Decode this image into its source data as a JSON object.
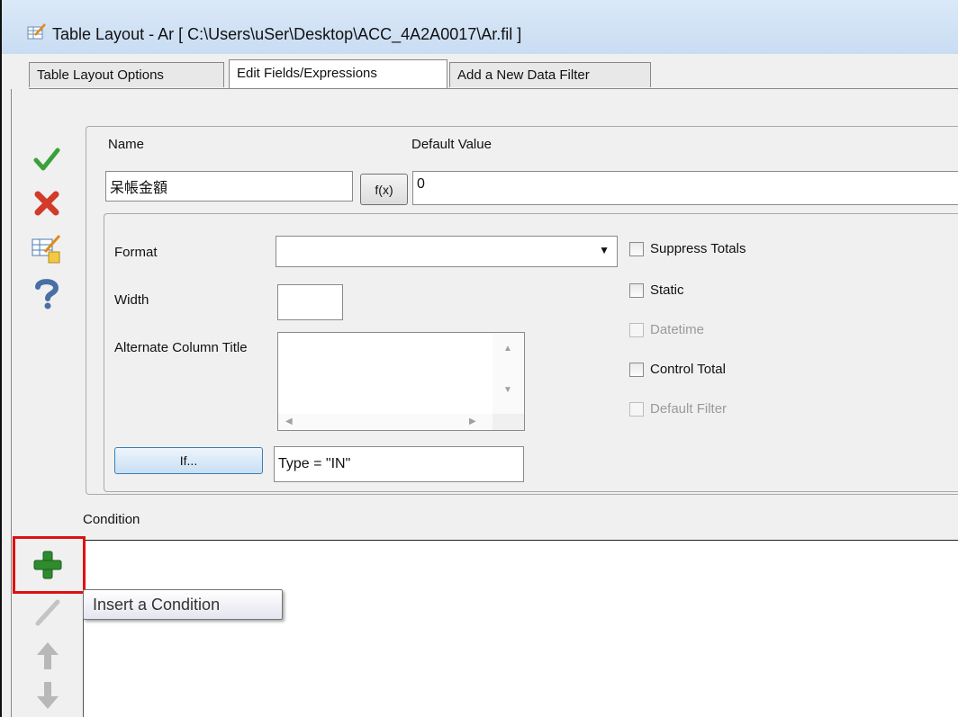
{
  "window": {
    "title": "Table Layout - Ar [ C:\\Users\\uSer\\Desktop\\ACC_4A2A0017\\Ar.fil ]"
  },
  "tabs": [
    {
      "label": "Table Layout Options",
      "active": false
    },
    {
      "label": "Edit Fields/Expressions",
      "active": true
    },
    {
      "label": "Add a New Data Filter",
      "active": false
    }
  ],
  "sidebar": {
    "icons": [
      "checkmark-icon",
      "delete-x-icon",
      "edit-table-icon",
      "help-question-icon"
    ]
  },
  "field": {
    "name_label": "Name",
    "name_value": "呆帳金額",
    "fx_label": "f(x)",
    "default_label": "Default Value",
    "default_value": "0",
    "format_label": "Format",
    "format_value": "",
    "width_label": "Width",
    "width_value": "",
    "alt_title_label": "Alternate Column Title",
    "alt_title_value": "",
    "if_button": "If...",
    "if_value": "Type = \"IN\""
  },
  "options": [
    {
      "label": "Suppress Totals",
      "checked": false,
      "enabled": true
    },
    {
      "label": "Static",
      "checked": false,
      "enabled": true
    },
    {
      "label": "Datetime",
      "checked": false,
      "enabled": false
    },
    {
      "label": "Control Total",
      "checked": false,
      "enabled": true
    },
    {
      "label": "Default Filter",
      "checked": false,
      "enabled": false
    }
  ],
  "condition": {
    "label": "Condition",
    "toolbar": [
      "plus-icon",
      "pencil-icon",
      "arrow-up-icon",
      "arrow-down-icon"
    ],
    "tooltip": "Insert a Condition"
  },
  "colors": {
    "highlight": "#e01010",
    "plus": "#2e8b2e",
    "title_bar": "#cfe0f4"
  }
}
